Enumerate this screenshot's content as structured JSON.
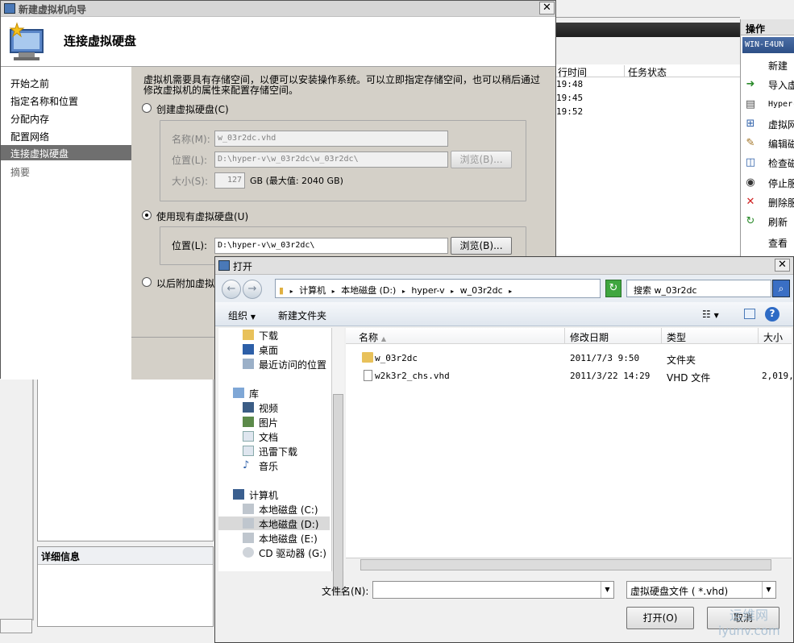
{
  "background": {
    "columns": {
      "time": "行时间",
      "status": "任务状态"
    },
    "rows": [
      "19:48",
      "19:45",
      "19:52"
    ],
    "actions_panel": {
      "title": "操作",
      "host": "WIN-E4UN",
      "items": [
        {
          "label": "新建",
          "icon": "none"
        },
        {
          "label": "导入虚",
          "icon": "import-icon"
        },
        {
          "label": "Hyper-",
          "icon": "settings-doc-icon"
        },
        {
          "label": "虚拟网",
          "icon": "network-icon"
        },
        {
          "label": "编辑磁",
          "icon": "edit-disk-icon"
        },
        {
          "label": "检查磁",
          "icon": "inspect-disk-icon"
        },
        {
          "label": "停止服",
          "icon": "stop-icon"
        },
        {
          "label": "删除服",
          "icon": "delete-icon"
        },
        {
          "label": "刷新",
          "icon": "refresh-icon"
        },
        {
          "label": "查看",
          "icon": "none"
        }
      ]
    },
    "details_title": "详细信息"
  },
  "wizard": {
    "title": "新建虚拟机向导",
    "header_title": "连接虚拟硬盘",
    "nav": [
      "开始之前",
      "指定名称和位置",
      "分配内存",
      "配置网络",
      "连接虚拟硬盘",
      "摘要"
    ],
    "active_nav_index": 4,
    "description": "虚拟机需要具有存储空间，以便可以安装操作系统。可以立即指定存储空间，也可以稍后通过修改虚拟机的属性来配置存储空间。",
    "create_option": "创建虚拟硬盘(C)",
    "name_label": "名称(M):",
    "name_value": "w_03r2dc.vhd",
    "location_label": "位置(L):",
    "location_value": "D:\\hyper-v\\w_03r2dc\\w_03r2dc\\",
    "browse_label": "浏览(B)...",
    "size_label": "大小(S):",
    "size_value": "127",
    "size_unit": "GB (最大值: 2040 GB)",
    "use_existing_option": "使用现有虚拟硬盘(U)",
    "existing_location_label": "位置(L):",
    "existing_location_value": "D:\\hyper-v\\w_03r2dc\\",
    "attach_later_option": "以后附加虚拟"
  },
  "open_dialog": {
    "title": "打开",
    "breadcrumb": [
      "计算机",
      "本地磁盘 (D:)",
      "hyper-v",
      "w_03r2dc"
    ],
    "search_placeholder": "搜索 w_03r2dc",
    "organize": "组织",
    "new_folder": "新建文件夹",
    "tree": [
      {
        "label": "下载",
        "icon": "download-folder-icon"
      },
      {
        "label": "桌面",
        "icon": "desktop-icon"
      },
      {
        "label": "最近访问的位置",
        "icon": "recent-places-icon"
      },
      {
        "label": "库",
        "icon": "library-icon"
      },
      {
        "label": "视频",
        "icon": "video-library-icon"
      },
      {
        "label": "图片",
        "icon": "picture-library-icon"
      },
      {
        "label": "文档",
        "icon": "document-library-icon"
      },
      {
        "label": "迅雷下载",
        "icon": "thunder-download-icon"
      },
      {
        "label": "音乐",
        "icon": "music-library-icon"
      },
      {
        "label": "计算机",
        "icon": "computer-icon"
      },
      {
        "label": "本地磁盘 (C:)",
        "icon": "system-drive-icon"
      },
      {
        "label": "本地磁盘 (D:)",
        "icon": "drive-icon"
      },
      {
        "label": "本地磁盘 (E:)",
        "icon": "drive-icon"
      },
      {
        "label": "CD 驱动器 (G:)",
        "icon": "cd-drive-icon"
      }
    ],
    "selected_tree_index": 11,
    "columns": {
      "name": "名称",
      "modified": "修改日期",
      "type": "类型",
      "size": "大小"
    },
    "files": [
      {
        "name": "w_03r2dc",
        "modified": "2011/7/3 9:50",
        "type": "文件夹",
        "size": "",
        "icon": "folder-icon"
      },
      {
        "name": "w2k3r2_chs.vhd",
        "modified": "2011/3/22 14:29",
        "type": "VHD 文件",
        "size": "2,019,",
        "icon": "file-icon"
      }
    ],
    "filename_label": "文件名(N):",
    "filename_value": "",
    "filetype_value": "虚拟硬盘文件 ( *.vhd)",
    "open_button": "打开(O)",
    "cancel_button": "取消"
  },
  "watermark": {
    "line1": "运维网",
    "line2": "iyunv.com"
  }
}
